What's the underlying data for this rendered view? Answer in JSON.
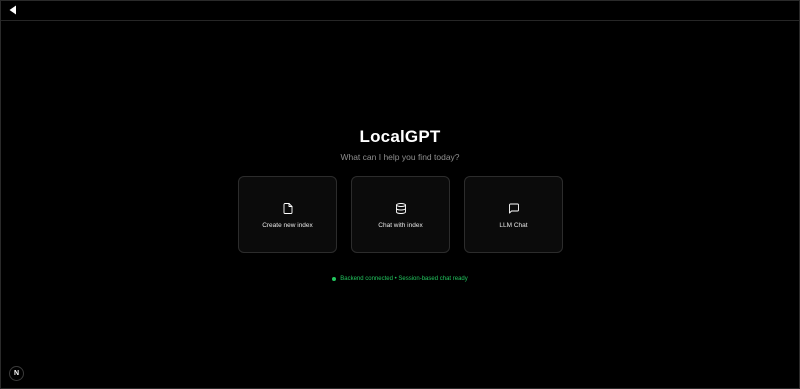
{
  "header": {
    "back_icon": "back-triangle-icon"
  },
  "hero": {
    "title": "LocalGPT",
    "subtitle": "What can I help you find today?"
  },
  "cards": [
    {
      "label": "Create new index",
      "icon": "file-icon"
    },
    {
      "label": "Chat with index",
      "icon": "database-icon"
    },
    {
      "label": "LLM Chat",
      "icon": "message-square-icon"
    }
  ],
  "status": {
    "text": "Backend connected • Session-based chat ready",
    "color": "#22c55e"
  },
  "corner_badge": {
    "letter": "N",
    "icon": "nextjs-logo-icon"
  }
}
